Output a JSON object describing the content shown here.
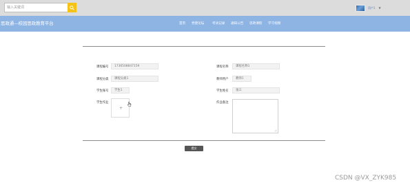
{
  "topbar": {
    "search_placeholder": "输入关键词",
    "user_name": "用户1"
  },
  "navbar": {
    "brand": "思政通—校园思政教育平台",
    "items": [
      "首页",
      "党建论坛",
      "考试记录",
      "通知公告",
      "思政课程",
      "学习视频"
    ]
  },
  "form": {
    "course_code_label": "课程编号",
    "course_code_value": "1736508847159",
    "course_name_label": "课程名称",
    "course_name_value": "课程名称1",
    "course_type_label": "课程分类",
    "course_type_value": "课程分类1",
    "teacher_label": "教师用户",
    "teacher_value": "教师1",
    "student_account_label": "学生账号",
    "student_account_value": "学生1",
    "student_name_label": "学生姓名",
    "student_name_value": "张三",
    "homework_label": "学生作业",
    "homework_upload_plus": "+",
    "notes_label": "作业备注"
  },
  "actions": {
    "submit_label": "提交"
  },
  "watermark": "CSDN @VX_ZYK985",
  "colors": {
    "navbar": "#8eb4e3",
    "search_button": "#f4c316",
    "topbar": "#dcdcdc",
    "submit_button": "#555555"
  },
  "icons": {
    "search": "search-icon",
    "upload": "plus-icon",
    "cursor": "hand-cursor-icon",
    "caret": "chevron-down-icon"
  }
}
